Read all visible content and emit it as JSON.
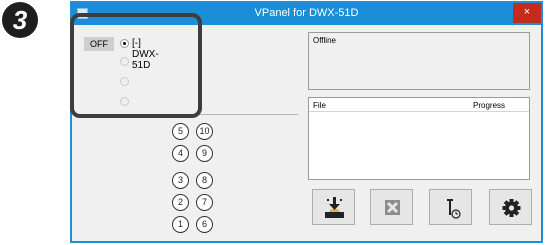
{
  "step_number": "3",
  "window": {
    "title": "VPanel for DWX-51D",
    "close_symbol": "×"
  },
  "machines": {
    "status_label": "OFF",
    "selected_label": "[-] DWX-51D"
  },
  "slots": [
    "5",
    "10",
    "4",
    "9",
    "3",
    "8",
    "2",
    "7",
    "1",
    "6"
  ],
  "status_panel": {
    "text": "Offline"
  },
  "file_list": {
    "col_file": "File",
    "col_progress": "Progress"
  },
  "actions": [
    {
      "icon": "output-icon"
    },
    {
      "icon": "cancel-icon"
    },
    {
      "icon": "tool-clock-icon"
    },
    {
      "icon": "gear-icon"
    }
  ],
  "colors": {
    "titlebar": "#1a8ed6",
    "close_button": "#c42b1c",
    "highlight_frame": "#3d3d3d",
    "badge": "#1e1e1e"
  }
}
